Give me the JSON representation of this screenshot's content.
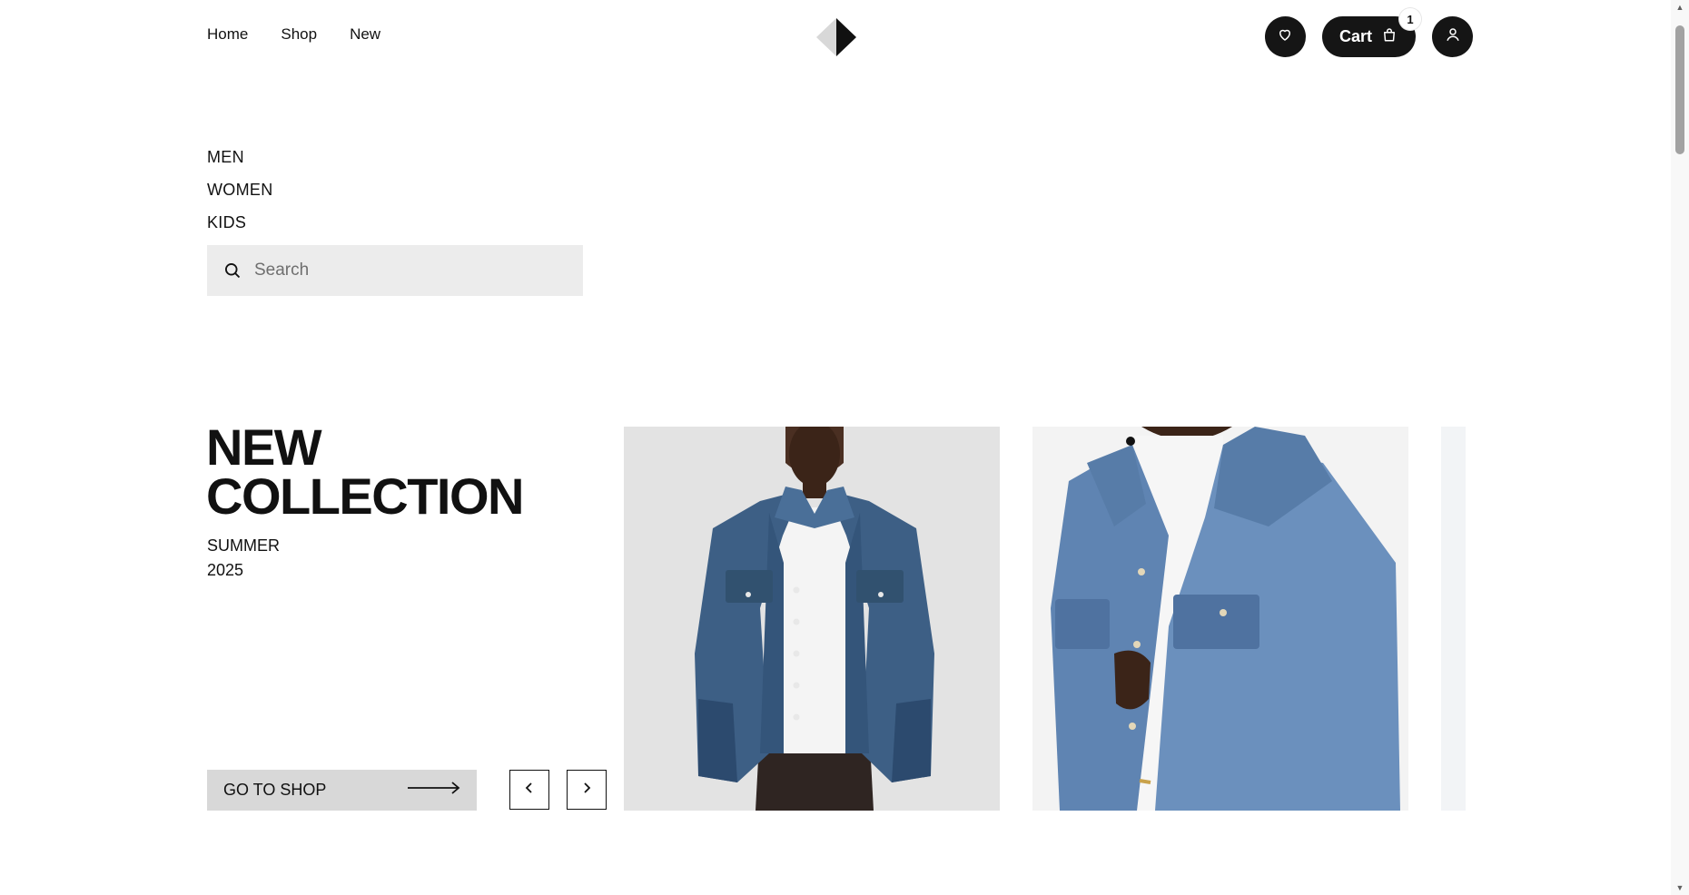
{
  "nav": {
    "links": [
      "Home",
      "Shop",
      "New"
    ]
  },
  "header": {
    "logo_icon": "diamond-logo-icon",
    "actions": {
      "wishlist_icon": "heart-icon",
      "cart_label": "Cart",
      "cart_icon": "shopping-bag-icon",
      "cart_count": "1",
      "account_icon": "user-icon"
    }
  },
  "categories": [
    "MEN",
    "WOMEN",
    "KIDS"
  ],
  "search": {
    "placeholder": "Search",
    "icon": "search-icon"
  },
  "hero": {
    "title_line1": "NEW",
    "title_line2": "COLLECTION",
    "subtitle_line1": "SUMMER",
    "subtitle_line2": "2025",
    "cta_label": "GO TO SHOP",
    "cta_icon": "arrow-right-icon",
    "prev_icon": "chevron-left-icon",
    "next_icon": "chevron-right-icon"
  },
  "slides": [
    {
      "subject": "model wearing dark denim jacket over white t-shirt"
    },
    {
      "subject": "close-up of light wash denim jacket"
    },
    {
      "subject": "partially visible next slide"
    }
  ],
  "colors": {
    "dark": "#151515",
    "light_gray": "#ececec",
    "cta_gray": "#d8d8d8",
    "denim": "#3d5f85"
  }
}
